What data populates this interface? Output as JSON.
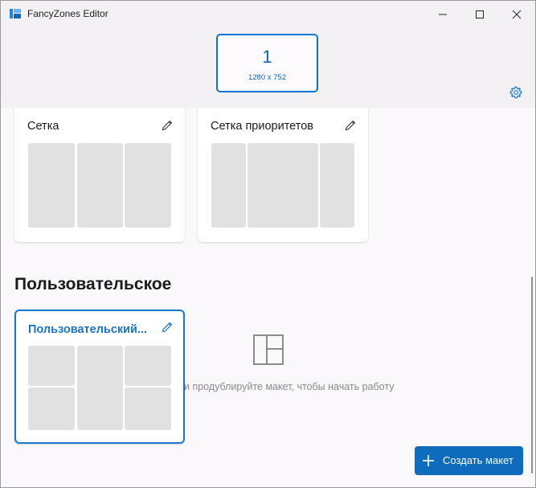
{
  "window": {
    "title": "FancyZones Editor"
  },
  "titlebar": {
    "minimize_icon": "minimize-icon",
    "maximize_icon": "maximize-icon",
    "close_icon": "close-icon"
  },
  "monitor": {
    "number": "1",
    "resolution": "1280 x 752",
    "selected": true
  },
  "settings_icon": "gear-icon",
  "templates": [
    {
      "title": "Сетка",
      "edit_icon": "pencil-icon"
    },
    {
      "title": "Сетка приоритетов",
      "edit_icon": "pencil-icon"
    }
  ],
  "custom_section": {
    "title": "Пользовательское",
    "layouts": [
      {
        "title": "Пользовательский...",
        "edit_icon": "pencil-icon",
        "selected": true
      }
    ],
    "empty_state_text": "и продублируйте макет, чтобы начать работу",
    "empty_state_icon": "layout-icon"
  },
  "create_button": {
    "label": "Создать макет",
    "icon": "plus-icon"
  },
  "colors": {
    "accent": "#0f6cbd",
    "zone": "#e1e1e1"
  }
}
